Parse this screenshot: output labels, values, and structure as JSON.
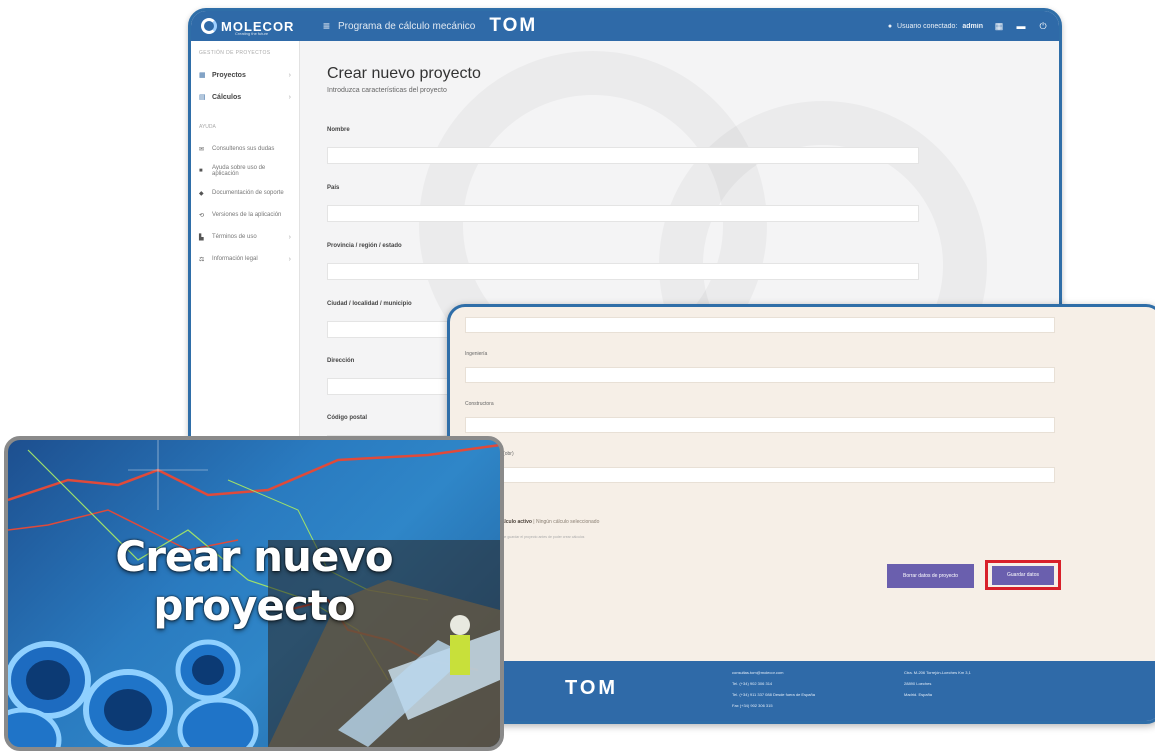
{
  "app": {
    "logo_text": "MOLECOR",
    "logo_sub": "Creating the future",
    "subtitle": "Programa de cálculo mecánico",
    "brand": "TOM",
    "user_label": "Usuario conectado:",
    "user_name": "admin",
    "brand_color": "#2f6aa8"
  },
  "sidebar": {
    "section1": "GESTIÓN DE PROYECTOS",
    "items": [
      {
        "label": "Proyectos",
        "icon": "grid-icon"
      },
      {
        "label": "Cálculos",
        "icon": "calculator-icon"
      }
    ],
    "section2": "AYUDA",
    "help_items": [
      {
        "label": "Consultenos sus dudas",
        "icon": "mail-icon"
      },
      {
        "label": "Ayuda sobre uso de aplicación",
        "icon": "book-icon"
      },
      {
        "label": "Documentación de soporte",
        "icon": "document-icon"
      },
      {
        "label": "Versiones de la aplicación",
        "icon": "tag-icon"
      },
      {
        "label": "Términos de uso",
        "icon": "file-icon"
      },
      {
        "label": "Información legal",
        "icon": "gavel-icon"
      }
    ]
  },
  "form": {
    "title": "Crear nuevo proyecto",
    "subtitle": "Introduzca características del proyecto",
    "fields": [
      {
        "label": "Nombre"
      },
      {
        "label": "País"
      },
      {
        "label": "Provincia / región / estado"
      },
      {
        "label": "Ciudad / localidad / municipio"
      },
      {
        "label": "Dirección"
      },
      {
        "label": "Código postal"
      }
    ]
  },
  "overlay": {
    "labels": [
      "Ingeniería",
      "Constructora",
      "Caso (obr)"
    ],
    "active_label": "Cálculo activo",
    "active_value": "Ningún cálculo seleccionado",
    "note": "Debe guardar el proyecto antes de poder crear cálculos",
    "reset_button": "Borrar datos de proyecto",
    "save_button": "Guardar datos",
    "highlight_color": "#d8202a"
  },
  "footer": {
    "brand": "TOM",
    "email": "consultas.tom@molecor.com",
    "tel1": "Tel. (+34) 902 306 314",
    "tel2": "Tel. (+34) 911 337 088 Desde fuera de España",
    "fax": "Fax (+34) 902 306 315",
    "company": "Ctra. M-206 Torrejón-Loeches Km 3,1",
    "city": "28890 Loeches",
    "country": "Madrid. España"
  },
  "promo": {
    "title": "Crear nuevo proyecto"
  }
}
